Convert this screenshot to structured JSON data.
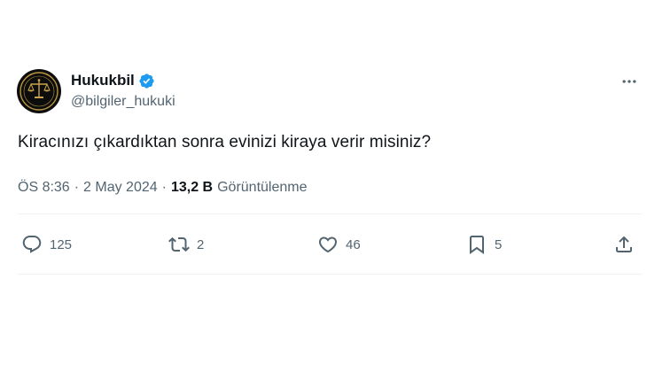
{
  "author": {
    "display_name": "Hukukbil",
    "handle": "@bilgiler_hukuki",
    "avatar_text": "HUKUKBIL",
    "verified_color": "#1d9bf0"
  },
  "tweet": {
    "text": "Kiracınızı çıkardıktan sonra evinizi kiraya verir misiniz?"
  },
  "meta": {
    "time": "ÖS 8:36",
    "separator": "·",
    "date": "2 May 2024",
    "views_count": "13,2 B",
    "views_label": "Görüntülenme"
  },
  "actions": {
    "replies": "125",
    "reposts": "2",
    "likes": "46",
    "bookmarks": "5"
  },
  "colors": {
    "text_primary": "#0f1419",
    "text_secondary": "#536471",
    "divider": "#eff3f4"
  }
}
